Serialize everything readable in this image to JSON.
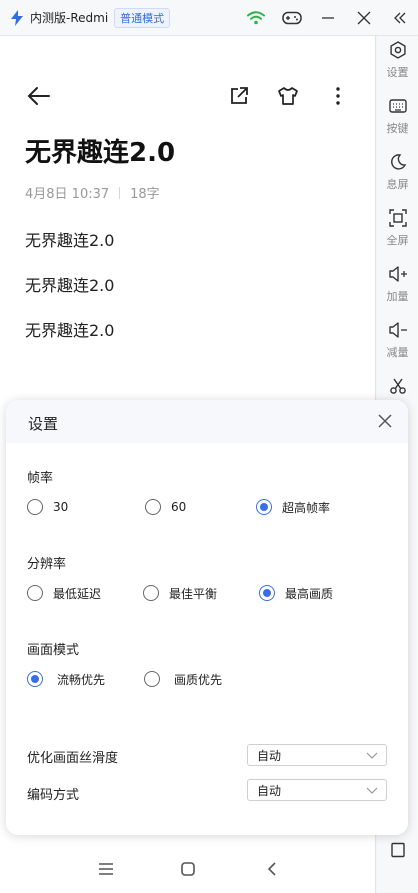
{
  "titlebar": {
    "app_title": "内测版-Redmi",
    "mode_badge": "普通模式"
  },
  "note": {
    "title": "无界趣连2.0",
    "date": "4月8日 10:37",
    "char_count": "18字",
    "lines": [
      "无界趣连2.0",
      "无界趣连2.0",
      "无界趣连2.0"
    ]
  },
  "sidebar": {
    "items": [
      {
        "label": "设置",
        "icon": "gear-icon"
      },
      {
        "label": "按键",
        "icon": "keyboard-icon"
      },
      {
        "label": "息屏",
        "icon": "moon-icon"
      },
      {
        "label": "全屏",
        "icon": "fullscreen-icon"
      },
      {
        "label": "加量",
        "icon": "volume-up-icon"
      },
      {
        "label": "减量",
        "icon": "volume-down-icon"
      },
      {
        "label": "",
        "icon": "scissors-icon"
      }
    ]
  },
  "settings": {
    "title": "设置",
    "frame_rate": {
      "title": "帧率",
      "options": [
        "30",
        "60",
        "超高帧率"
      ],
      "selected": "超高帧率"
    },
    "resolution": {
      "title": "分辨率",
      "options": [
        "最低延迟",
        "最佳平衡",
        "最高画质"
      ],
      "selected": "最高画质"
    },
    "picture_mode": {
      "title": "画面模式",
      "options": [
        "流畅优先",
        "画质优先"
      ],
      "selected": "流畅优先"
    },
    "smoothness": {
      "label": "优化画面丝滑度",
      "value": "自动"
    },
    "encoding": {
      "label": "编码方式",
      "value": "自动"
    }
  },
  "colors": {
    "accent": "#3a6ee8",
    "wifi": "#2fb24c"
  }
}
